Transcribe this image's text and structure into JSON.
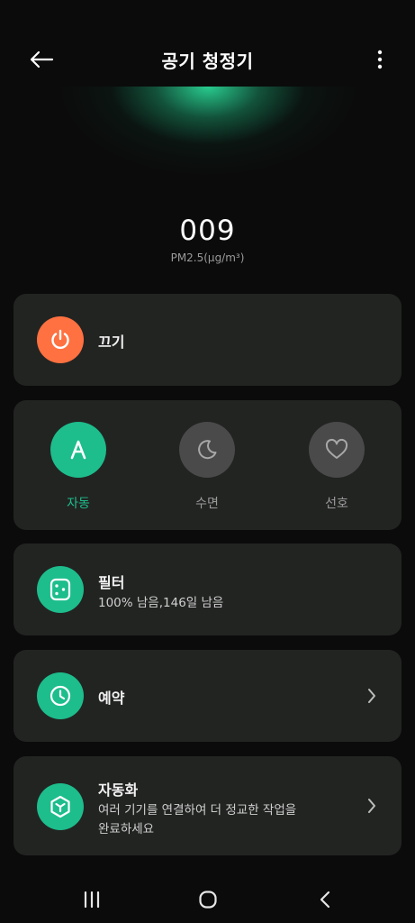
{
  "header": {
    "title": "공기 청정기",
    "back_icon": "arrow-left-icon",
    "more_icon": "more-vertical-icon"
  },
  "air_quality": {
    "value": "009",
    "unit": "PM2.5(μg/m³)"
  },
  "power": {
    "label": "끄기",
    "icon": "power-icon",
    "color": "#ff7140"
  },
  "modes": [
    {
      "label": "자동",
      "icon": "auto-a-icon",
      "active": true
    },
    {
      "label": "수면",
      "icon": "moon-icon",
      "active": false
    },
    {
      "label": "선호",
      "icon": "heart-icon",
      "active": false
    }
  ],
  "filter": {
    "label": "필터",
    "status": "100% 남음,146일 남음",
    "icon": "filter-icon"
  },
  "schedule": {
    "label": "예약",
    "icon": "clock-icon"
  },
  "automation": {
    "label": "자동화",
    "description_line1": "여러 기기를 연결하여 더 정교한 작업을",
    "description_line2": "완료하세요",
    "icon": "automation-cube-icon"
  },
  "colors": {
    "accent": "#1dbd8c",
    "card_bg": "#222422",
    "inactive_circle": "#4a4a4a"
  },
  "navbar": {
    "recent_icon": "recent-apps-icon",
    "home_icon": "home-icon",
    "back_icon": "nav-back-icon"
  }
}
